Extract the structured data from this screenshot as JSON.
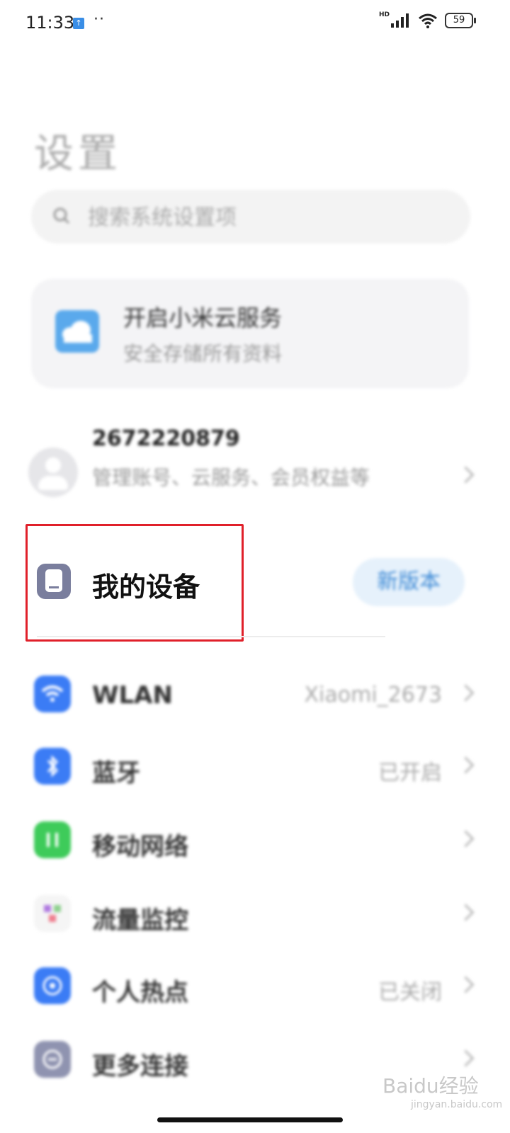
{
  "status_bar": {
    "time": "11:33",
    "dots": "··",
    "network": "HD",
    "battery": "59"
  },
  "page_title": "设置",
  "search": {
    "placeholder": "搜索系统设置项"
  },
  "cloud_card": {
    "title": "开启小米云服务",
    "subtitle": "安全存储所有资料"
  },
  "account": {
    "id": "2672220879",
    "description": "管理账号、云服务、会员权益等"
  },
  "device": {
    "label": "我的设备",
    "badge": "新版本"
  },
  "settings_items": [
    {
      "label": "WLAN",
      "value": "Xiaomi_2673",
      "icon": "wifi-icon",
      "color": "#3b7cf5"
    },
    {
      "label": "蓝牙",
      "value": "已开启",
      "icon": "bluetooth-icon",
      "color": "#3b7cf5"
    },
    {
      "label": "移动网络",
      "value": "",
      "icon": "mobile-network-icon",
      "color": "#3ecb5a"
    },
    {
      "label": "流量监控",
      "value": "",
      "icon": "data-usage-icon",
      "color": "#f5f5f5"
    },
    {
      "label": "个人热点",
      "value": "已关闭",
      "icon": "hotspot-icon",
      "color": "#3b7cf5"
    },
    {
      "label": "更多连接",
      "value": "",
      "icon": "more-connections-icon",
      "color": "#8f93b0"
    }
  ],
  "watermark": {
    "text": "Baidu经验",
    "sub": "jingyan.baidu.com"
  }
}
